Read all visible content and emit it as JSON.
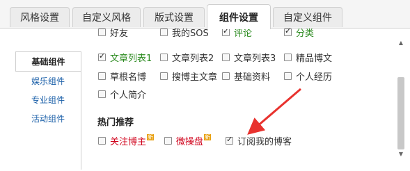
{
  "tabs": [
    {
      "label": "风格设置"
    },
    {
      "label": "自定义风格"
    },
    {
      "label": "版式设置"
    },
    {
      "label": "组件设置"
    },
    {
      "label": "自定义组件"
    }
  ],
  "sidebar": {
    "items": [
      {
        "label": "基础组件"
      },
      {
        "label": "娱乐组件"
      },
      {
        "label": "专业组件"
      },
      {
        "label": "活动组件"
      }
    ]
  },
  "components": {
    "row0": [
      {
        "label": "好友"
      },
      {
        "label": "我的SOS"
      },
      {
        "label": "评论"
      },
      {
        "label": "分类"
      }
    ],
    "row1": [
      {
        "label": "文章列表1",
        "checked": true
      },
      {
        "label": "文章列表2",
        "checked": false
      },
      {
        "label": "文章列表3",
        "checked": false
      },
      {
        "label": "精品博文",
        "checked": false
      }
    ],
    "row2": [
      {
        "label": "草根名博",
        "checked": false
      },
      {
        "label": "搜博主文章",
        "checked": false
      },
      {
        "label": "基础资料",
        "checked": false
      },
      {
        "label": "个人经历",
        "checked": false
      }
    ],
    "row3": [
      {
        "label": "个人简介",
        "checked": false
      }
    ]
  },
  "hot": {
    "heading": "热门推荐",
    "items": [
      {
        "label": "关注博主",
        "badge": "新",
        "checked": false
      },
      {
        "label": "微操盘",
        "badge": "新",
        "checked": false
      },
      {
        "label": "订阅我的博客",
        "checked": true
      }
    ]
  },
  "colors": {
    "accent_link": "#1a5fa8",
    "green_label": "#2b8a1f",
    "red_label": "#d0021b",
    "annotation_arrow": "#e8322e"
  }
}
